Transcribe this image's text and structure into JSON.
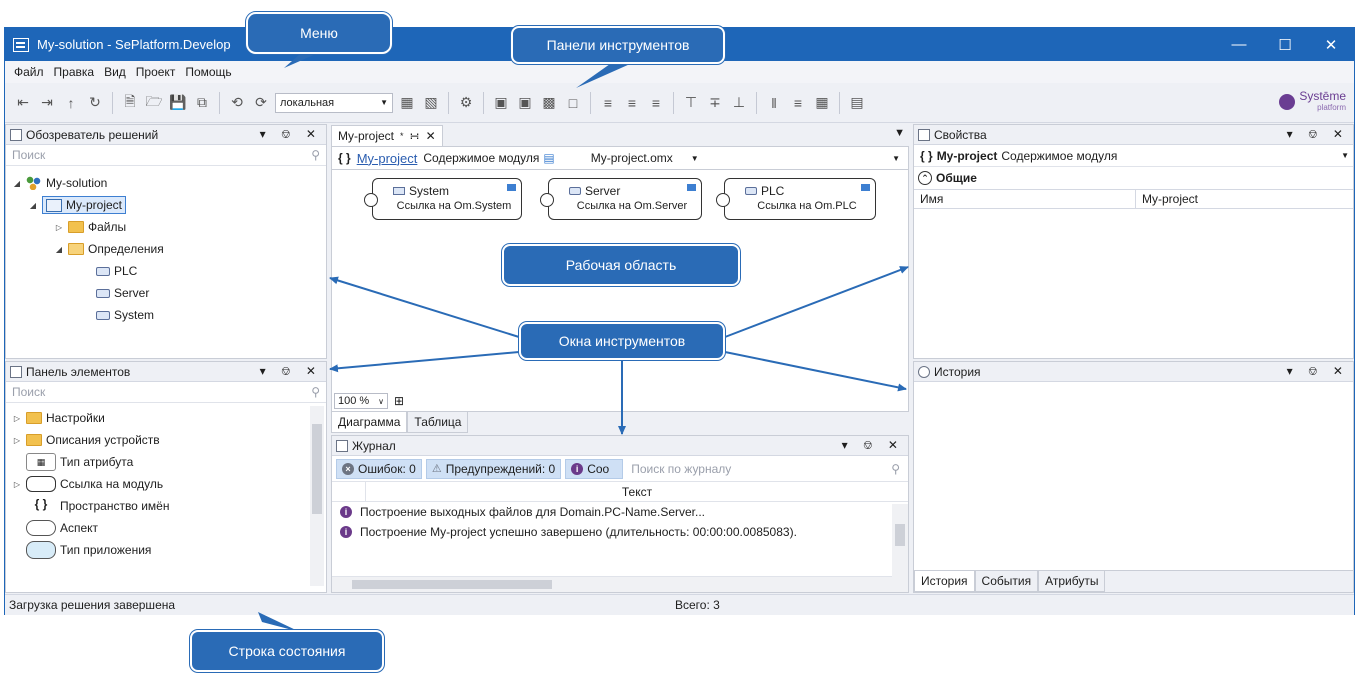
{
  "window": {
    "title": "My-solution - SePlatform.Develop"
  },
  "menu": [
    "Файл",
    "Правка",
    "Вид",
    "Проект",
    "Помощь"
  ],
  "toolbar": {
    "build_config": "локальная",
    "brand_name": "Systēme",
    "brand_sub": "platform"
  },
  "solution_explorer": {
    "title": "Обозреватель решений",
    "search_placeholder": "Поиск",
    "items": [
      {
        "label": "My-solution"
      },
      {
        "label": "My-project"
      },
      {
        "label": "Файлы"
      },
      {
        "label": "Определения"
      },
      {
        "label": "PLC"
      },
      {
        "label": "Server"
      },
      {
        "label": "System"
      }
    ]
  },
  "toolbox": {
    "title": "Панель элементов",
    "search_placeholder": "Поиск",
    "items": [
      {
        "label": "Настройки"
      },
      {
        "label": "Описания устройств"
      },
      {
        "label": "Тип атрибута"
      },
      {
        "label": "Ссылка на модуль"
      },
      {
        "label": "Пространство имён"
      },
      {
        "label": "Аспект"
      },
      {
        "label": "Тип приложения"
      }
    ]
  },
  "document": {
    "tab": "My-project",
    "header_link": "My-project",
    "header_text": "Содержимое модуля",
    "file": "My-project.omx",
    "blocks": [
      {
        "title": "System",
        "subtitle": "Ссылка на Om.System"
      },
      {
        "title": "Server",
        "subtitle": "Ссылка на Om.Server"
      },
      {
        "title": "PLC",
        "subtitle": "Ссылка на Om.PLC"
      }
    ],
    "zoom": "100 %",
    "tabs": [
      "Диаграмма",
      "Таблица"
    ]
  },
  "properties": {
    "title": "Свойства",
    "header_bold": "My-project",
    "header_text": "Содержимое модуля",
    "section": "Общие",
    "rows": [
      {
        "name": "Имя",
        "value": "My-project"
      }
    ]
  },
  "history": {
    "title": "История",
    "tabs": [
      "История",
      "События",
      "Атрибуты"
    ]
  },
  "journal": {
    "title": "Журнал",
    "errors": "Ошибок: 0",
    "warnings": "Предупреждений: 0",
    "messages": "Соо",
    "search_placeholder": "Поиск по журналу",
    "column": "Текст",
    "rows": [
      "Построение выходных файлов для Domain.PC-Name.Server...",
      "Построение My-project успешно завершено (длительность: 00:00:00.0085083)."
    ]
  },
  "status": {
    "left": "Загрузка решения завершена",
    "center": "Всего: 3"
  },
  "callouts": {
    "menu": "Меню",
    "toolbars": "Панели инструментов",
    "workspace": "Рабочая область",
    "tool_windows": "Окна инструментов",
    "statusbar": "Строка состояния"
  },
  "colors": {
    "titlebar": "#1e66b8",
    "callout": "#2a6bb6",
    "accent": "#3d7fd1"
  }
}
